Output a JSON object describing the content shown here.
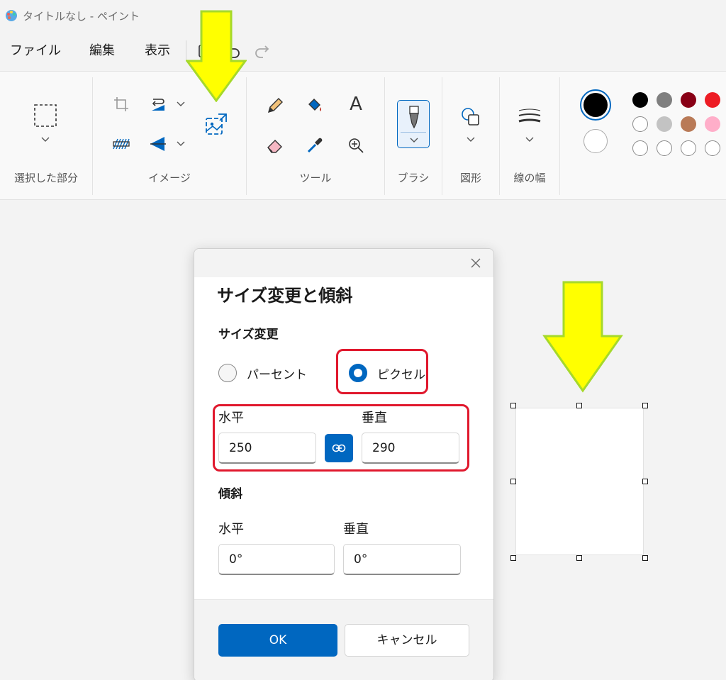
{
  "window": {
    "title": "タイトルなし - ペイント"
  },
  "menu": {
    "items": [
      "ファイル",
      "編集",
      "表示"
    ]
  },
  "ribbon": {
    "groups": {
      "selection": "選択した部分",
      "image": "イメージ",
      "tools": "ツール",
      "brushes": "ブラシ",
      "shapes": "図形",
      "line_width": "線の幅"
    },
    "text_tool_glyph": "A"
  },
  "colors": {
    "accent": "#0067c0",
    "annotation_red": "#e0182d",
    "arrow_yellow": "#ffff00",
    "arrow_outline": "#a6d92a",
    "primary_color": "#000000",
    "secondary_color": "#ffffff",
    "palette": [
      "#000000",
      "#7f7f7f",
      "#880015",
      "#ed1c24",
      "#ffffff",
      "#c3c3c3",
      "#b97a57",
      "#ffaec9",
      "#ffffff",
      "#ffffff",
      "#ffffff",
      "#ffffff"
    ]
  },
  "dialog": {
    "title": "サイズ変更と傾斜",
    "resize_section": "サイズ変更",
    "percent_option": "パーセント",
    "pixel_option": "ピクセル",
    "selected_option": "ピクセル",
    "horizontal_label": "水平",
    "vertical_label": "垂直",
    "resize_horizontal": "250",
    "resize_vertical": "290",
    "skew_section": "傾斜",
    "skew_horizontal_label": "水平",
    "skew_vertical_label": "垂直",
    "skew_horizontal": "0°",
    "skew_vertical": "0°",
    "ok_label": "OK",
    "cancel_label": "キャンセル"
  }
}
